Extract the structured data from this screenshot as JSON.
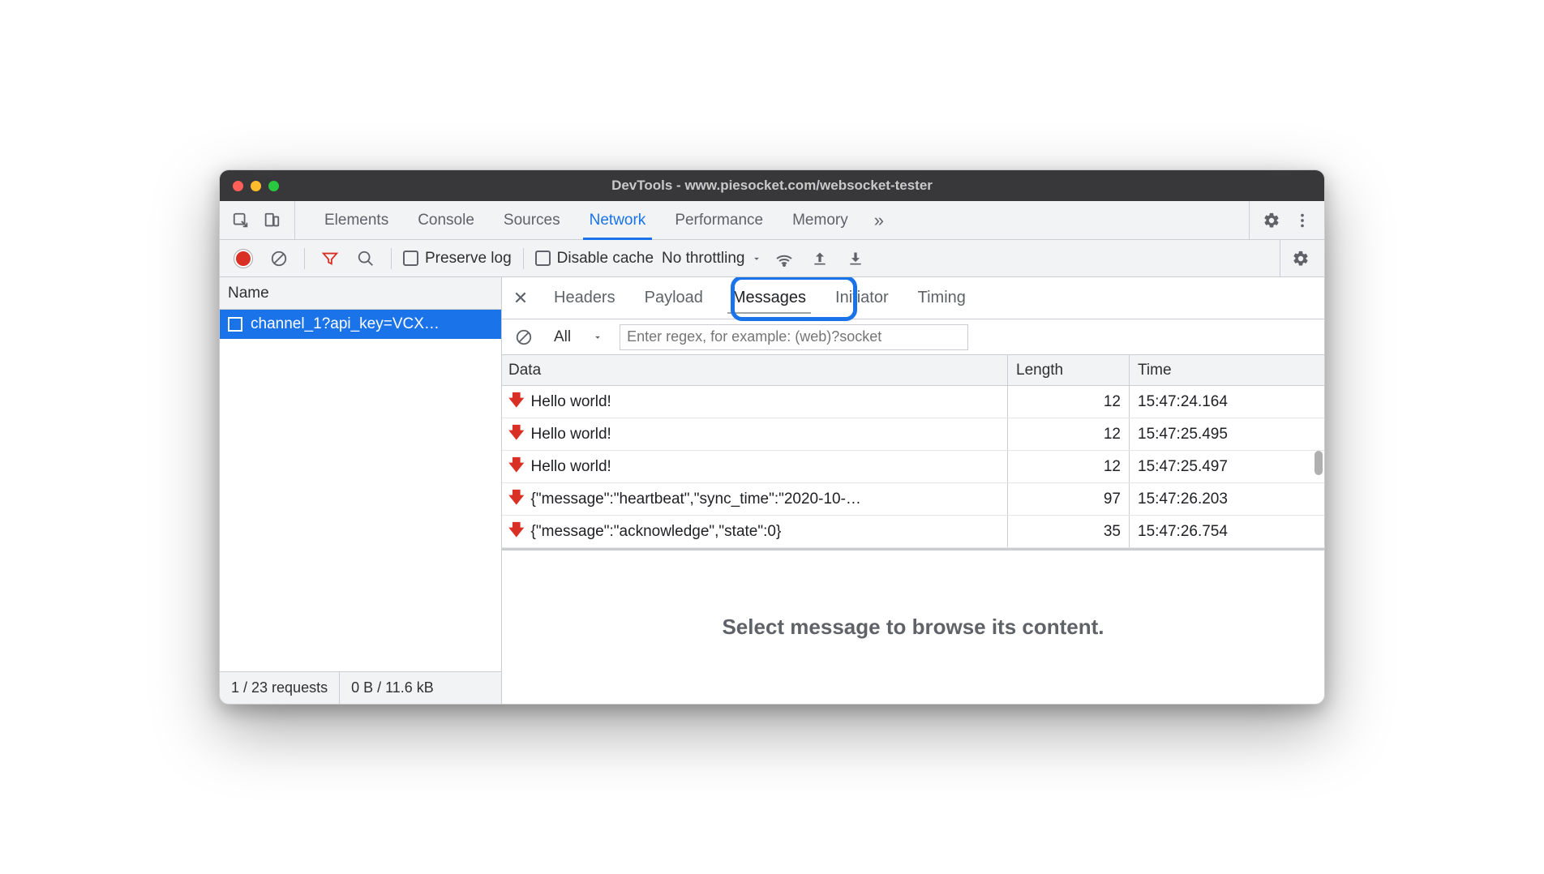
{
  "window": {
    "title": "DevTools - www.piesocket.com/websocket-tester"
  },
  "main_tabs": {
    "items": [
      "Elements",
      "Console",
      "Sources",
      "Network",
      "Performance",
      "Memory"
    ],
    "active_index": 3,
    "more": "»"
  },
  "net_toolbar": {
    "preserve_log": "Preserve log",
    "disable_cache": "Disable cache",
    "throttling": "No throttling"
  },
  "left_pane": {
    "header": "Name",
    "request": "channel_1?api_key=VCX…",
    "footer_requests": "1 / 23 requests",
    "footer_bytes": "0 B / 11.6 kB"
  },
  "detail_tabs": {
    "items": [
      "Headers",
      "Payload",
      "Messages",
      "Initiator",
      "Timing"
    ],
    "active_index": 2
  },
  "msg_filter": {
    "all": "All",
    "regex_placeholder": "Enter regex, for example: (web)?socket"
  },
  "msg_table": {
    "headers": {
      "data": "Data",
      "length": "Length",
      "time": "Time"
    },
    "rows": [
      {
        "dir": "down",
        "data": "Hello world!",
        "length": "12",
        "time": "15:47:24.164"
      },
      {
        "dir": "down",
        "data": "Hello world!",
        "length": "12",
        "time": "15:47:25.495"
      },
      {
        "dir": "down",
        "data": "Hello world!",
        "length": "12",
        "time": "15:47:25.497"
      },
      {
        "dir": "down",
        "data": "{\"message\":\"heartbeat\",\"sync_time\":\"2020-10-…",
        "length": "97",
        "time": "15:47:26.203"
      },
      {
        "dir": "down",
        "data": "{\"message\":\"acknowledge\",\"state\":0}",
        "length": "35",
        "time": "15:47:26.754"
      }
    ]
  },
  "placeholder": "Select message to browse its content."
}
